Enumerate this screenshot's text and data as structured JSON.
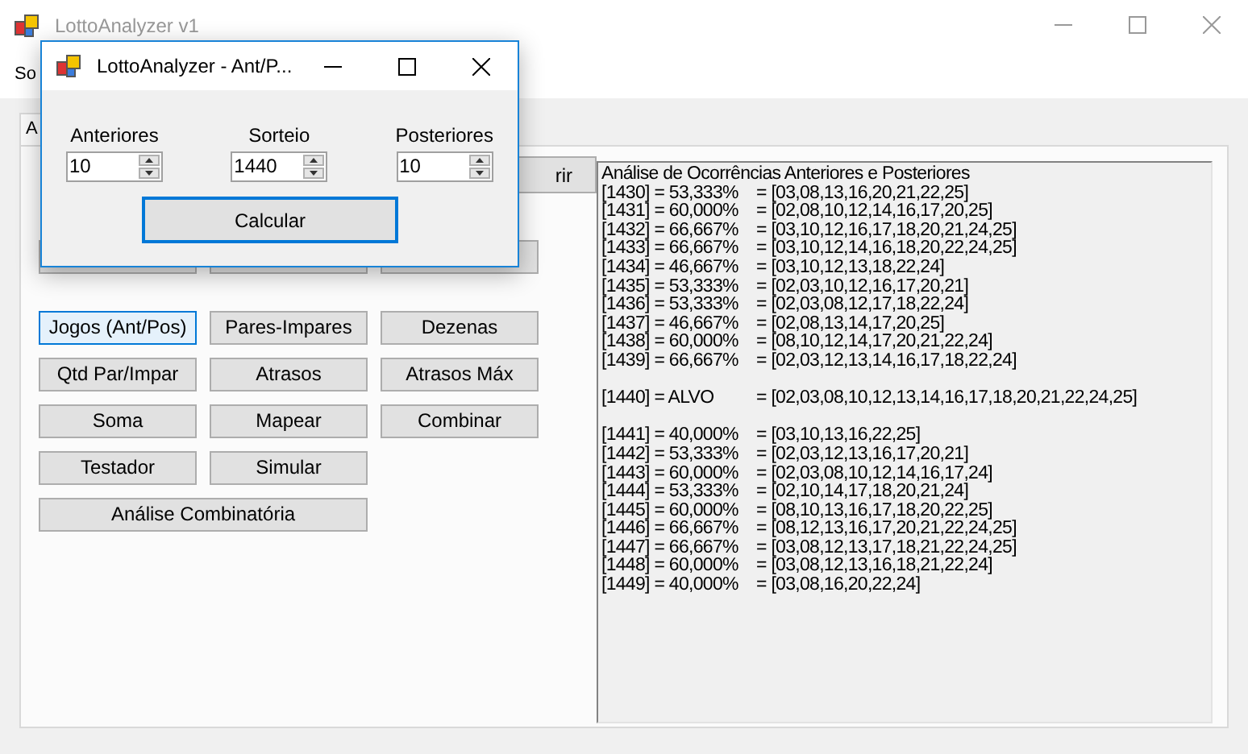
{
  "main_window": {
    "title": "LottoAnalyzer v1",
    "menu": [
      "So"
    ],
    "tabs": [
      {
        "label": "A",
        "selected": true
      }
    ],
    "partial_button": "rir",
    "buttons": [
      {
        "label": "Jogos (Ant/Pos)",
        "kind": "normal",
        "focused": true
      },
      {
        "label": "Pares-Impares",
        "kind": "normal",
        "focused": false
      },
      {
        "label": "Dezenas",
        "kind": "normal",
        "focused": false
      },
      {
        "label": "Qtd Par/Impar",
        "kind": "normal",
        "focused": false
      },
      {
        "label": "Atrasos",
        "kind": "normal",
        "focused": false
      },
      {
        "label": "Atrasos Máx",
        "kind": "normal",
        "focused": false
      },
      {
        "label": "Soma",
        "kind": "normal",
        "focused": false
      },
      {
        "label": "Mapear",
        "kind": "normal",
        "focused": false
      },
      {
        "label": "Combinar",
        "kind": "normal",
        "focused": false
      },
      {
        "label": "Testador",
        "kind": "normal",
        "focused": false
      },
      {
        "label": "Simular",
        "kind": "normal",
        "focused": false
      },
      {
        "label": "Análise Combinatória",
        "kind": "wide",
        "focused": false
      }
    ],
    "output": {
      "heading": "Análise de Ocorrências Anteriores e Posteriores",
      "sections": [
        [
          {
            "ref": "[1430] = 53,333%",
            "numbers": "= [03,08,13,16,20,21,22,25]"
          },
          {
            "ref": "[1431] = 60,000%",
            "numbers": "= [02,08,10,12,14,16,17,20,25]"
          },
          {
            "ref": "[1432] = 66,667%",
            "numbers": "= [03,10,12,16,17,18,20,21,24,25]"
          },
          {
            "ref": "[1433] = 66,667%",
            "numbers": "= [03,10,12,14,16,18,20,22,24,25]"
          },
          {
            "ref": "[1434] = 46,667%",
            "numbers": "= [03,10,12,13,18,22,24]"
          },
          {
            "ref": "[1435] = 53,333%",
            "numbers": "= [02,03,10,12,16,17,20,21]"
          },
          {
            "ref": "[1436] = 53,333%",
            "numbers": "= [02,03,08,12,17,18,22,24]"
          },
          {
            "ref": "[1437] = 46,667%",
            "numbers": "= [02,08,13,14,17,20,25]"
          },
          {
            "ref": "[1438] = 60,000%",
            "numbers": "= [08,10,12,14,17,20,21,22,24]"
          },
          {
            "ref": "[1439] = 66,667%",
            "numbers": "= [02,03,12,13,14,16,17,18,22,24]"
          }
        ],
        [
          {
            "ref": "[1440] = ALVO",
            "numbers": "= [02,03,08,10,12,13,14,16,17,18,20,21,22,24,25]"
          }
        ],
        [
          {
            "ref": "[1441] = 40,000%",
            "numbers": "= [03,10,13,16,22,25]"
          },
          {
            "ref": "[1442] = 53,333%",
            "numbers": "= [02,03,12,13,16,17,20,21]"
          },
          {
            "ref": "[1443] = 60,000%",
            "numbers": "= [02,03,08,10,12,14,16,17,24]"
          },
          {
            "ref": "[1444] = 53,333%",
            "numbers": "= [02,10,14,17,18,20,21,24]"
          },
          {
            "ref": "[1445] = 60,000%",
            "numbers": "= [08,10,13,16,17,18,20,22,25]"
          },
          {
            "ref": "[1446] = 66,667%",
            "numbers": "= [08,12,13,16,17,20,21,22,24,25]"
          },
          {
            "ref": "[1447] = 66,667%",
            "numbers": "= [03,08,12,13,17,18,21,22,24,25]"
          },
          {
            "ref": "[1448] = 60,000%",
            "numbers": "= [03,08,12,13,16,18,21,22,24]"
          },
          {
            "ref": "[1449] = 40,000%",
            "numbers": "= [03,08,16,20,22,24]"
          }
        ]
      ]
    }
  },
  "dialog": {
    "title": "LottoAnalyzer - Ant/P...",
    "fields": [
      {
        "label": "Anteriores",
        "value": "10"
      },
      {
        "label": "Sorteio",
        "value": "1440"
      },
      {
        "label": "Posteriores",
        "value": "10"
      }
    ],
    "button": {
      "label": "Calcular",
      "focused": true
    }
  }
}
